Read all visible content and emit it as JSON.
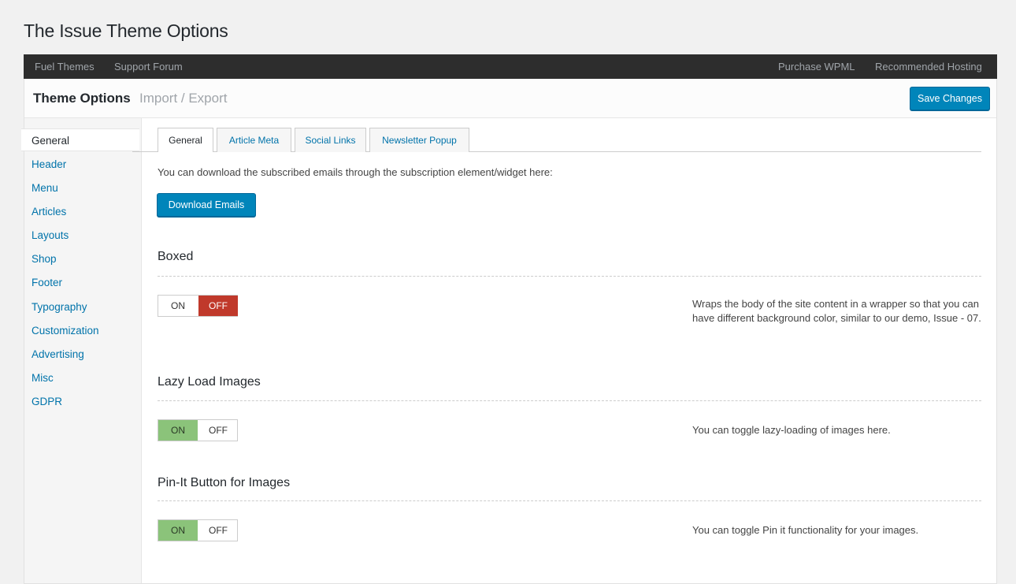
{
  "page": {
    "title": "The Issue Theme Options"
  },
  "topbar": {
    "left_links": [
      "Fuel Themes",
      "Support Forum"
    ],
    "right_links": [
      "Purchase WPML",
      "Recommended Hosting"
    ]
  },
  "header": {
    "title": "Theme Options",
    "subtitle": "Import / Export",
    "save_label": "Save Changes"
  },
  "sidebar": {
    "items": [
      {
        "label": "General",
        "active": true
      },
      {
        "label": "Header"
      },
      {
        "label": "Menu"
      },
      {
        "label": "Articles"
      },
      {
        "label": "Layouts"
      },
      {
        "label": "Shop"
      },
      {
        "label": "Footer"
      },
      {
        "label": "Typography"
      },
      {
        "label": "Customization"
      },
      {
        "label": "Advertising"
      },
      {
        "label": "Misc"
      },
      {
        "label": "GDPR"
      }
    ]
  },
  "tabs": [
    {
      "label": "General",
      "active": true
    },
    {
      "label": "Article Meta"
    },
    {
      "label": "Social Links"
    },
    {
      "label": "Newsletter Popup"
    }
  ],
  "download": {
    "text": "You can download the subscribed emails through the subscription element/widget here:",
    "button_label": "Download Emails"
  },
  "options": [
    {
      "title": "Boxed",
      "on_label": "ON",
      "off_label": "OFF",
      "state": "OFF",
      "description": "Wraps the body of the site content in a wrapper so that you can have different background color, similar to our demo, Issue - 07."
    },
    {
      "title": "Lazy Load Images",
      "on_label": "ON",
      "off_label": "OFF",
      "state": "ON",
      "description": "You can toggle lazy-loading of images here."
    },
    {
      "title": "Pin-It Button for Images",
      "on_label": "ON",
      "off_label": "OFF",
      "state": "ON",
      "description": "You can toggle Pin it functionality for your images."
    }
  ],
  "colors": {
    "accent": "#0085ba",
    "off_active": "#c0392b",
    "on_active": "#8bc37a",
    "topbar": "#2d2d2d"
  }
}
